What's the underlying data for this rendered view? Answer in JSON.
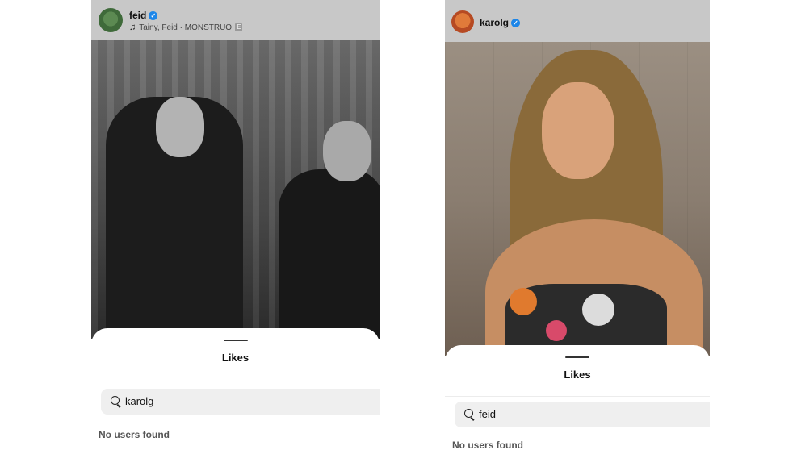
{
  "left": {
    "post": {
      "username": "feid",
      "verified_mark": "✓",
      "song_icon": "music-note-icon",
      "song_text": "Tainy, Feid · MONSTRUO",
      "explicit_badge": "E"
    },
    "likes_sheet": {
      "title": "Likes",
      "search_value": "karolg",
      "empty_state": "No users found"
    }
  },
  "right": {
    "post": {
      "username": "karolg",
      "verified_mark": "✓"
    },
    "likes_sheet": {
      "title": "Likes",
      "search_value": "feid",
      "empty_state": "No users found"
    }
  },
  "colors": {
    "verified_blue": "#1d86e8",
    "header_overlay": "#c8c8c8",
    "search_bg": "#efefef"
  }
}
